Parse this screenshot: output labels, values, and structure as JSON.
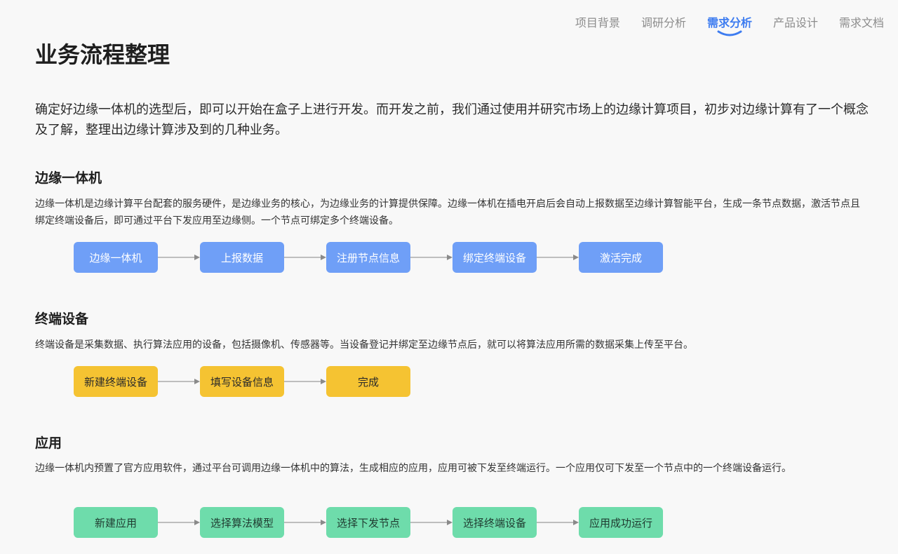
{
  "nav": {
    "items": [
      {
        "label": "项目背景",
        "active": false
      },
      {
        "label": "调研分析",
        "active": false
      },
      {
        "label": "需求分析",
        "active": true
      },
      {
        "label": "产品设计",
        "active": false
      },
      {
        "label": "需求文档",
        "active": false
      }
    ]
  },
  "page": {
    "title": "业务流程整理",
    "intro": "确定好边缘一体机的选型后，即可以开始在盒子上进行开发。而开发之前，我们通过使用并研究市场上的边缘计算项目，初步对边缘计算有了一个概念及了解，整理出边缘计算涉及到的几种业务。"
  },
  "sections": [
    {
      "title": "边缘一体机",
      "desc": "边缘一体机是边缘计算平台配套的服务硬件，是边缘业务的核心，为边缘业务的计算提供保障。边缘一体机在插电开启后会自动上报数据至边缘计算智能平台，生成一条节点数据，激活节点且绑定终端设备后，即可通过平台下发应用至边缘侧。一个节点可绑定多个终端设备。",
      "steps": [
        "边缘一体机",
        "上报数据",
        "注册节点信息",
        "绑定终端设备",
        "激活完成"
      ]
    },
    {
      "title": "终端设备",
      "desc": "终端设备是采集数据、执行算法应用的设备，包括摄像机、传感器等。当设备登记并绑定至边缘节点后，就可以将算法应用所需的数据采集上传至平台。",
      "steps": [
        "新建终端设备",
        "填写设备信息",
        "完成"
      ]
    },
    {
      "title": "应用",
      "desc": "边缘一体机内预置了官方应用软件，通过平台可调用边缘一体机中的算法，生成相应的应用，应用可被下发至终端运行。一个应用仅可下发至一个节点中的一个终端设备运行。",
      "steps": [
        "新建应用",
        "选择算法模型",
        "选择下发节点",
        "选择终端设备",
        "应用成功运行"
      ]
    }
  ],
  "colors": {
    "accent": "#3d7cf0",
    "flow_blue": "#6f9ff7",
    "flow_yellow": "#f5c332",
    "flow_green": "#6edcab",
    "arrow": "#9a9a9a"
  }
}
